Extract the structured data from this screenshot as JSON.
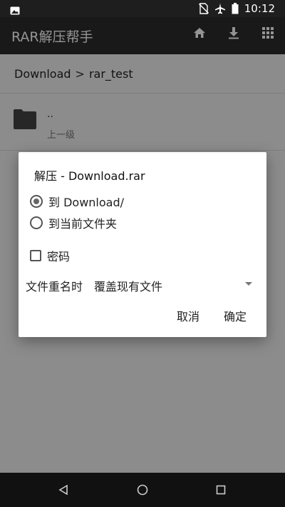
{
  "status_bar": {
    "time": "10:12",
    "icons": [
      "image-icon",
      "no-sim-icon",
      "airplane-icon",
      "battery-icon"
    ]
  },
  "app_bar": {
    "title": "RAR解压帮手",
    "actions": [
      "home-icon",
      "download-icon",
      "grid-icon"
    ]
  },
  "breadcrumb": {
    "items": [
      "Download",
      "rar_test"
    ],
    "separator": ">"
  },
  "list": {
    "items": [
      {
        "name": "..",
        "subtitle": "上一级",
        "icon": "folder-icon"
      }
    ]
  },
  "dialog": {
    "title": "解压 - Download.rar",
    "options": [
      {
        "label": "到 Download/",
        "checked": true
      },
      {
        "label": "到当前文件夹",
        "checked": false
      }
    ],
    "password": {
      "label": "密码",
      "checked": false
    },
    "rename": {
      "label": "文件重名时",
      "value": "覆盖现有文件"
    },
    "buttons": {
      "cancel": "取消",
      "ok": "确定"
    }
  },
  "nav_bar": {
    "buttons": [
      "back-icon",
      "home-circle-icon",
      "recents-icon"
    ]
  },
  "colors": {
    "app_bar": "#2b2b2b",
    "status_bar": "#1e1e1e",
    "content_bg": "#f2f2f2",
    "dialog_bg": "#ffffff",
    "nav_bar": "#111111"
  }
}
